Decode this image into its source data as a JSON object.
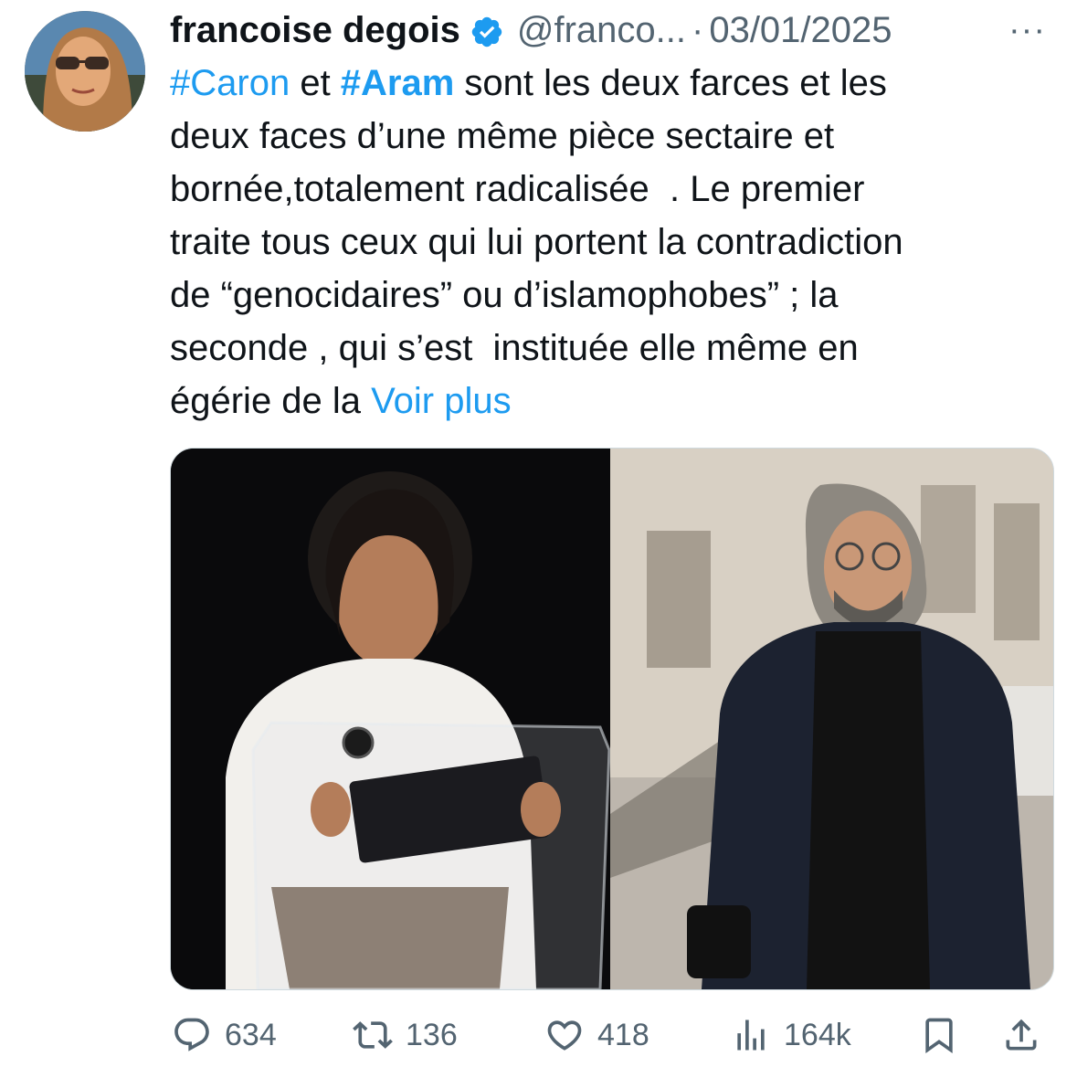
{
  "author": {
    "name": "francoise degois",
    "handle": "@franco...",
    "separator": "·",
    "date": "03/01/2025",
    "verified_icon": "verified-badge-icon",
    "more_label": "···"
  },
  "tweet": {
    "line1": {
      "tag1": "#Caron",
      "mid": " et ",
      "tag2": "#Aram",
      "rest": " sont les deux farces et les"
    },
    "line2": "deux faces d’une même pièce sectaire et",
    "line3": "bornée,totalement radicalisée  . Le premier",
    "line4": "traite tous ceux qui lui portent la contradiction",
    "line5": "de “genocidaires” ou d’islamophobes” ; la",
    "line6": "seconde , qui s’est  instituée elle même en",
    "line7": {
      "text": "égérie de la ",
      "more_link": "Voir plus"
    }
  },
  "actions": {
    "replies": "634",
    "retweets": "136",
    "likes": "418",
    "views": "164k",
    "icons": [
      "reply-icon",
      "retweet-icon",
      "like-icon",
      "views-icon",
      "bookmark-icon",
      "share-icon"
    ]
  },
  "colors": {
    "link": "#1d9bf0",
    "secondary_text": "#536471",
    "verified": "#1d9bf0"
  }
}
